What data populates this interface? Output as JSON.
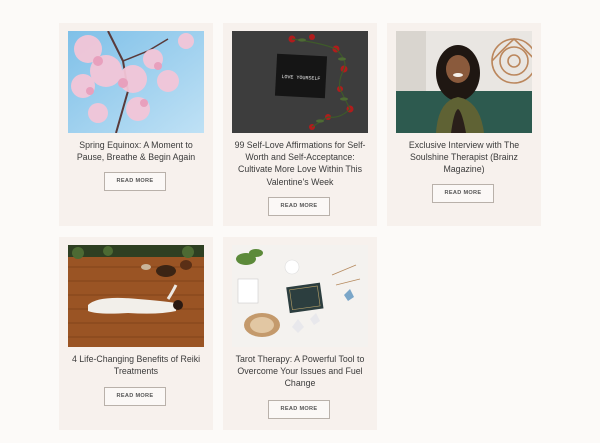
{
  "posts": [
    {
      "title": "Spring Equinox: A Moment to Pause, Breathe & Begin Again",
      "button": "READ MORE",
      "image": "cherry-blossom-photo"
    },
    {
      "title": "99 Self-Love Affirmations for Self-Worth and Self-Acceptance: Cultivate More Love Within This Valentine's Week",
      "button": "READ MORE",
      "image": "love-yourself-board-roses-photo",
      "image_text": "LOVE YOURSELF"
    },
    {
      "title": "Exclusive Interview with The Soulshine Therapist (Brainz Magazine)",
      "button": "READ MORE",
      "image": "therapist-portrait-photo"
    },
    {
      "title": "4 Life-Changing Benefits of Reiki Treatments",
      "button": "READ MORE",
      "image": "reiki-treatment-photo"
    },
    {
      "title": "Tarot Therapy: A Powerful Tool to Overcome Your Issues and Fuel Change",
      "button": "READ MORE",
      "image": "tarot-cards-crystals-photo"
    }
  ],
  "colors": {
    "page_bg": "#fcfaf8",
    "card_bg": "#f7f1ed",
    "button_border": "#b9b1aa",
    "text": "#3b3b3b"
  }
}
